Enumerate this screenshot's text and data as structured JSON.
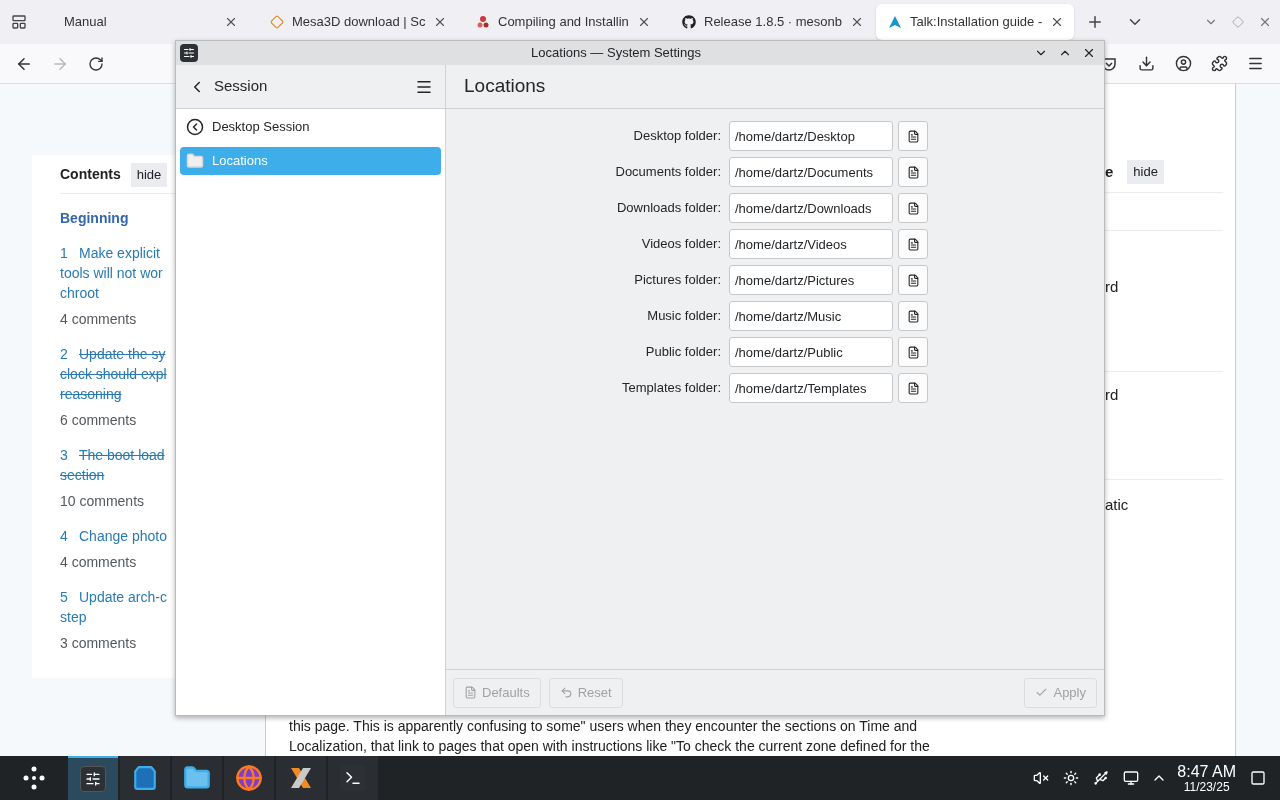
{
  "browser": {
    "tabs": [
      {
        "title": "Manual",
        "kind": "plain",
        "selected": false
      },
      {
        "title": "Mesa3D download | Sc",
        "kind": "diamond",
        "selected": false
      },
      {
        "title": "Compiling and Installin",
        "kind": "dots",
        "selected": false
      },
      {
        "title": "Release 1.8.5 · mesonb",
        "kind": "github",
        "selected": false
      },
      {
        "title": "Talk:Installation guide -",
        "kind": "arch",
        "selected": true
      }
    ],
    "nav": [
      {
        "kind": "back",
        "disabled": false
      },
      {
        "kind": "forward",
        "disabled": true
      },
      {
        "kind": "reload",
        "disabled": false
      }
    ]
  },
  "page": {
    "contents": {
      "title": "Contents",
      "hide": "hide",
      "beginning": "Beginning",
      "items": [
        {
          "number": "1",
          "lines": [
            "Make explicit",
            "tools will not wor",
            "chroot"
          ],
          "struck": false,
          "comments": "4 comments"
        },
        {
          "number": "2",
          "lines": [
            "Update the sy",
            "clock should expl",
            "reasoning"
          ],
          "struck": true,
          "comments": "6 comments"
        },
        {
          "number": "3",
          "lines": [
            "The boot load",
            "section"
          ],
          "struck": true,
          "comments": "10 comments"
        },
        {
          "number": "4",
          "lines": [
            "Change photo"
          ],
          "struck": false,
          "comments": "4 comments"
        },
        {
          "number": "5",
          "lines": [
            "Update arch-c",
            "step"
          ],
          "struck": false,
          "comments": "3 comments"
        }
      ]
    },
    "side_box": {
      "heading_end": "e",
      "hide": "hide",
      "fragments": [
        "rd",
        "rd",
        "atic"
      ]
    },
    "paragraph_lines": [
      "this page. This is apparently confusing to some\" users when they encounter the sections on Time and",
      "Localization, that link to pages that open with instructions like \"To check the current zone defined for the"
    ]
  },
  "dialog": {
    "title": "Locations — System Settings",
    "sidebar_title": "Session",
    "page_title": "Locations",
    "sidebar_items": [
      {
        "label": "Desktop Session",
        "kind": "back",
        "selected": false
      },
      {
        "label": "Locations",
        "kind": "folder",
        "selected": true
      }
    ],
    "folders": [
      {
        "label": "Desktop folder:",
        "value": "/home/dartz/Desktop"
      },
      {
        "label": "Documents folder:",
        "value": "/home/dartz/Documents"
      },
      {
        "label": "Downloads folder:",
        "value": "/home/dartz/Downloads"
      },
      {
        "label": "Videos folder:",
        "value": "/home/dartz/Videos"
      },
      {
        "label": "Pictures folder:",
        "value": "/home/dartz/Pictures"
      },
      {
        "label": "Music folder:",
        "value": "/home/dartz/Music"
      },
      {
        "label": "Public folder:",
        "value": "/home/dartz/Public"
      },
      {
        "label": "Templates folder:",
        "value": "/home/dartz/Templates"
      }
    ],
    "footer": [
      {
        "label": "Defaults",
        "kind": "defaults",
        "disabled": true
      },
      {
        "label": "Reset",
        "kind": "reset",
        "disabled": true
      },
      {
        "label": "Apply",
        "kind": "apply",
        "disabled": true
      }
    ]
  },
  "taskbar": {
    "tasks": [
      {
        "kind": "settings",
        "selected": true
      },
      {
        "kind": "store",
        "selected": false
      },
      {
        "kind": "files",
        "selected": false
      },
      {
        "kind": "browser",
        "selected": false
      },
      {
        "kind": "xampp",
        "selected": false
      },
      {
        "kind": "terminal",
        "selected": false
      }
    ],
    "time": "8:47 AM",
    "date": "11/23/25"
  }
}
